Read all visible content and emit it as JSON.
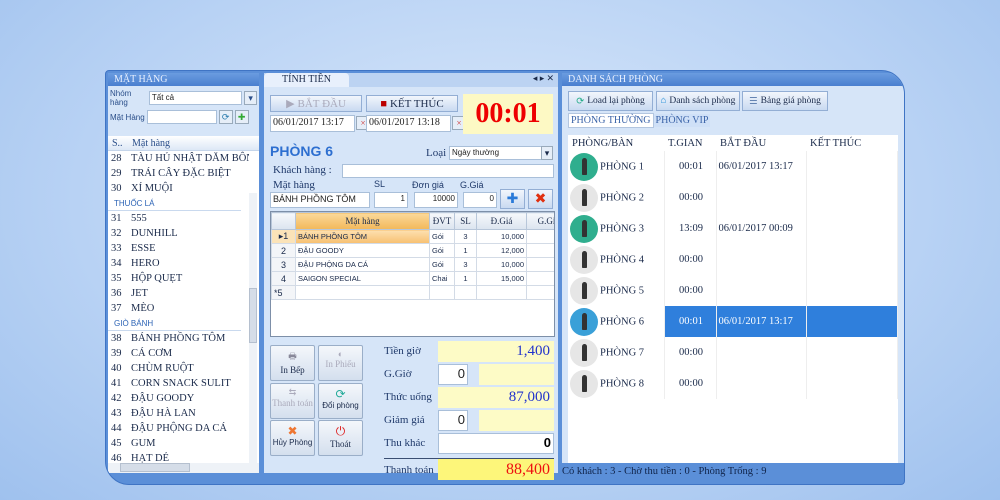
{
  "left": {
    "title": "MẶT HÀNG",
    "group_label": "Nhóm hàng",
    "group_value": "Tất cả",
    "item_label": "Mặt Hàng",
    "col_stt": "S..",
    "col_name": "Mặt hàng",
    "items": [
      {
        "n": "28",
        "name": "TÀU HỦ NHẬT DĂM BÔNG"
      },
      {
        "n": "29",
        "name": "TRÁI CÂY ĐẶC BIỆT"
      },
      {
        "n": "30",
        "name": "XÍ MUỘI"
      },
      {
        "group": "THUỐC LÁ"
      },
      {
        "n": "31",
        "name": "555"
      },
      {
        "n": "32",
        "name": "DUNHILL"
      },
      {
        "n": "33",
        "name": "ESSE"
      },
      {
        "n": "34",
        "name": "HERO"
      },
      {
        "n": "35",
        "name": "HỘP QUẸT"
      },
      {
        "n": "36",
        "name": "JET"
      },
      {
        "n": "37",
        "name": "MÈO"
      },
      {
        "group": "GIÒ BÁNH"
      },
      {
        "n": "38",
        "name": "BÁNH PHỒNG TÔM"
      },
      {
        "n": "39",
        "name": "CÁ CƠM"
      },
      {
        "n": "40",
        "name": "CHÙM RUỘT"
      },
      {
        "n": "41",
        "name": "CORN SNACK SULIT"
      },
      {
        "n": "42",
        "name": "ĐẬU GOODY"
      },
      {
        "n": "43",
        "name": "ĐẬU HÀ LAN"
      },
      {
        "n": "44",
        "name": "ĐẬU PHỘNG DA CÁ"
      },
      {
        "n": "45",
        "name": "GUM"
      },
      {
        "n": "46",
        "name": "HẠT DẺ"
      }
    ]
  },
  "mid": {
    "tab": "TÍNH TIỀN",
    "start_label": "BẮT ĐẦU",
    "end_label": "KẾT THÚC",
    "start_time": "06/01/2017 13:17",
    "end_time": "06/01/2017 13:18",
    "timer": "00:01",
    "room": "PHÒNG 6",
    "loai_label": "Loại",
    "loai_value": "Ngày thường",
    "customer_label": "Khách hàng :",
    "item_label": "Mặt hàng",
    "sl_label": "SL",
    "price_label": "Đơn giá",
    "disc_label": "G.Giá",
    "item_value": "BÁNH PHỒNG TÔM",
    "sl_value": "1",
    "price_value": "10000",
    "disc_value": "0",
    "cols": [
      "Mặt hàng",
      "ĐVT",
      "SL",
      "Đ.Giá",
      "G.Giá"
    ],
    "rows": [
      {
        "i": "1",
        "name": "BÁNH PHỒNG TÔM",
        "unit": "Gói",
        "sl": "3",
        "price": "10,000"
      },
      {
        "i": "2",
        "name": "ĐẬU GOODY",
        "unit": "Gói",
        "sl": "1",
        "price": "12,000"
      },
      {
        "i": "3",
        "name": "ĐẬU PHỘNG DA CÁ",
        "unit": "Gói",
        "sl": "3",
        "price": "10,000"
      },
      {
        "i": "4",
        "name": "SAIGON SPECIAL",
        "unit": "Chai",
        "sl": "1",
        "price": "15,000"
      }
    ],
    "new_row": "5",
    "buttons": {
      "in_bep": "In Bếp",
      "in_phieu": "In Phiếu",
      "thanh_toan": "Thanh toán",
      "doi_phong": "Đổi phòng",
      "huy_phong": "Hủy Phòng",
      "thoat": "Thoát"
    },
    "summary": {
      "tien_gio_label": "Tiền giờ",
      "tien_gio": "1,400",
      "g_gio_label": "G.Giờ",
      "g_gio": "0",
      "thuc_uong_label": "Thức uống",
      "thuc_uong": "87,000",
      "giam_gia_label": "Giảm giá",
      "giam_gia": "0",
      "thu_khac_label": "Thu khác",
      "thu_khac": "0",
      "thanh_toan_label": "Thanh toán",
      "thanh_toan": "88,400"
    }
  },
  "right": {
    "title": "DANH SÁCH PHÒNG",
    "btn_reload": "Load lại phòng",
    "btn_list": "Danh sách phòng",
    "btn_price": "Bảng giá phòng",
    "tab_normal": "PHÒNG THƯỜNG",
    "tab_vip": "PHÒNG VIP",
    "cols": [
      "PHÒNG/BÀN",
      "T.GIAN",
      "BẮT ĐẦU",
      "KẾT THÚC"
    ],
    "rooms": [
      {
        "name": "PHÒNG 1",
        "time": "00:01",
        "start": "06/01/2017 13:17",
        "state": "on"
      },
      {
        "name": "PHÒNG 2",
        "time": "00:00",
        "start": "",
        "state": "off"
      },
      {
        "name": "PHÒNG 3",
        "time": "13:09",
        "start": "06/01/2017 00:09",
        "state": "on"
      },
      {
        "name": "PHÒNG 4",
        "time": "00:00",
        "start": "",
        "state": "off"
      },
      {
        "name": "PHÒNG 5",
        "time": "00:00",
        "start": "",
        "state": "off"
      },
      {
        "name": "PHÒNG 6",
        "time": "00:01",
        "start": "06/01/2017 13:17",
        "state": "sel"
      },
      {
        "name": "PHÒNG 7",
        "time": "00:00",
        "start": "",
        "state": "off"
      },
      {
        "name": "PHÒNG 8",
        "time": "00:00",
        "start": "",
        "state": "off"
      }
    ],
    "status": "Có khách : 3  -  Chờ thu tiền : 0  -  Phòng Trống : 9"
  }
}
